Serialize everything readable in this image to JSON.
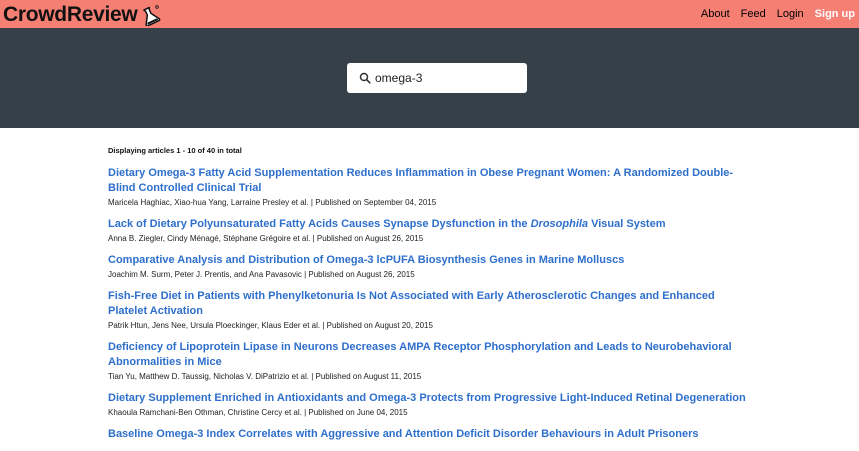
{
  "app": {
    "brand": "CrowdReview",
    "logo_icon": "flask-icon"
  },
  "nav": {
    "items": [
      "About",
      "Feed",
      "Login",
      "Sign up"
    ]
  },
  "search": {
    "value": "omega-3",
    "icon": "search-icon"
  },
  "results": {
    "summary": "Displaying articles 1 - 10 of 40 in total",
    "articles": [
      {
        "title": "Dietary Omega-3 Fatty Acid Supplementation Reduces Inflammation in Obese Pregnant Women: A Randomized Double-Blind Controlled Clinical Trial",
        "meta": "Maricela Haghiac, Xiao-hua Yang, Larraine Presley et al. | Published on September 04, 2015"
      },
      {
        "title_before": "Lack of Dietary Polyunsaturated Fatty Acids Causes Synapse Dysfunction in the ",
        "title_italic": "Drosophila",
        "title_after": " Visual System",
        "meta": "Anna B. Ziegler, Cindy Ménagé, Stéphane Grégoire et al. | Published on August 26, 2015"
      },
      {
        "title": "Comparative Analysis and Distribution of Omega-3 lcPUFA Biosynthesis Genes in Marine Molluscs",
        "meta": "Joachim M. Surm, Peter J. Prentis, and Ana Pavasovic | Published on August 26, 2015"
      },
      {
        "title": "Fish-Free Diet in Patients with Phenylketonuria Is Not Associated with Early Atherosclerotic Changes and Enhanced Platelet Activation",
        "meta": "Patrik Htun, Jens Nee, Ursula Ploeckinger, Klaus Eder et al. | Published on August 20, 2015"
      },
      {
        "title": "Deficiency of Lipoprotein Lipase in Neurons Decreases AMPA Receptor Phosphorylation and Leads to Neurobehavioral Abnormalities in Mice",
        "meta": "Tian Yu, Matthew D. Taussig, Nicholas V. DiPatrizio et al. | Published on August 11, 2015"
      },
      {
        "title": "Dietary Supplement Enriched in Antioxidants and Omega-3 Protects from Progressive Light-Induced Retinal Degeneration",
        "meta": "Khaoula Ramchani-Ben Othman, Christine Cercy et al. | Published on June 04, 2015"
      },
      {
        "title": "Baseline Omega-3 Index Correlates with Aggressive and Attention Deficit Disorder Behaviours in Adult Prisoners",
        "meta": ""
      }
    ]
  },
  "colors": {
    "topbar": "#f67f74",
    "hero": "#364049",
    "link": "#2e6fcc"
  }
}
